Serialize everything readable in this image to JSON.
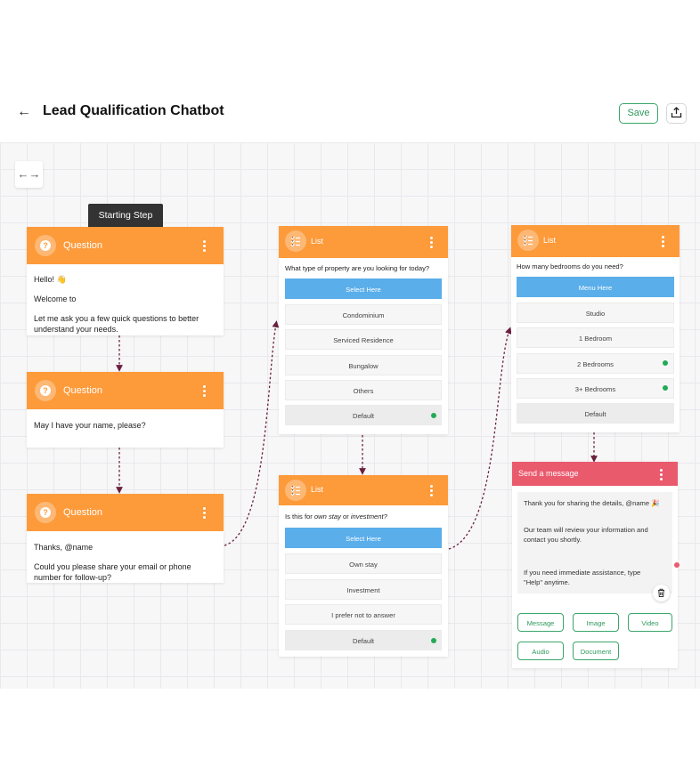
{
  "header": {
    "title": "Lead Qualification Chatbot",
    "save_label": "Save"
  },
  "colors": {
    "node_header": "#fd9a3a",
    "send_header": "#ea5a6d",
    "selected_option": "#5aaeea",
    "accent_green": "#2f9a5e",
    "connector": "#6b1f3e"
  },
  "canvas": {
    "starting_step_label": "Starting Step"
  },
  "question1": {
    "header": "Question",
    "line1": "Hello! 👋",
    "line2": "Welcome to",
    "line3": "Let me ask you a few quick questions to better",
    "line4": "understand your needs."
  },
  "question2": {
    "header": "Question",
    "text": "May I have your name, please?"
  },
  "question3": {
    "header": "Question",
    "line1": "Thanks, @name",
    "line2": "Could you please share your email or phone",
    "line3": "number for follow-up?"
  },
  "list1": {
    "header": "List",
    "question": "What type of property are you looking for today?",
    "button": "Select Here",
    "options": [
      "Condominium",
      "Serviced Residence",
      "Bungalow",
      "Others",
      "Default"
    ]
  },
  "list2": {
    "header": "List",
    "question_prefix": "Is this for ",
    "question_em1": "own stay",
    "question_mid": " or ",
    "question_em2": "investment?",
    "button": "Select Here",
    "options": [
      "Own stay",
      "Investment",
      "I prefer not to answer",
      "Default"
    ]
  },
  "list3": {
    "header": "List",
    "question": "How many bedrooms do you need?",
    "button": "Menu Here",
    "options": [
      "Studio",
      "1 Bedroom",
      "2 Bedrooms",
      "3+ Bedrooms",
      "Default"
    ]
  },
  "send_message": {
    "header": "Send a message",
    "line1": "Thank you for sharing the details, @name 🎉",
    "line2": "Our team will review your information and",
    "line3": "contact you shortly.",
    "line4": "If you need immediate assistance, type",
    "line5": "\"Help\" anytime.",
    "buttons": [
      "Message",
      "Image",
      "Video",
      "Audio",
      "Document"
    ]
  }
}
